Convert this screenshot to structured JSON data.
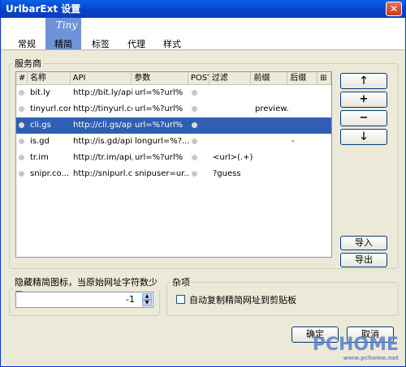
{
  "window": {
    "title": "UrlbarExt 设置",
    "close_label": "✕"
  },
  "tabs": [
    {
      "label": "常规",
      "active": false
    },
    {
      "label": "精简",
      "active": true,
      "icon_text": "Tiny"
    },
    {
      "label": "标签",
      "active": false
    },
    {
      "label": "代理",
      "active": false
    },
    {
      "label": "样式",
      "active": false
    }
  ],
  "providers": {
    "legend": "服务商",
    "columns": [
      "#",
      "名称",
      "API",
      "参数",
      "POST",
      "过滤",
      "前缀",
      "后缀",
      "⊞"
    ],
    "rows": [
      {
        "name": "bit.ly",
        "api": "http://bit.ly/api",
        "params": "url=%?url%",
        "post": "",
        "filter": "",
        "prefix": "",
        "suffix": "",
        "status": "off",
        "selected": false
      },
      {
        "name": "tinyurl.com",
        "api": "http://tinyurl.co...",
        "params": "url=%?url%",
        "post": "",
        "filter": "",
        "prefix": "preview.",
        "suffix": "",
        "status": "off",
        "selected": false
      },
      {
        "name": "cli.gs",
        "api": "http://cli.gs/ap...",
        "params": "url=%?url%",
        "post": "",
        "filter": "",
        "prefix": "",
        "suffix": "",
        "status": "ok",
        "selected": true
      },
      {
        "name": "is.gd",
        "api": "http://is.gd/api...",
        "params": "longurl=%?...",
        "post": "",
        "filter": "",
        "prefix": "",
        "suffix": "-",
        "status": "off",
        "selected": false
      },
      {
        "name": "tr.im",
        "api": "http://tr.im/api/...",
        "params": "url=%?url%",
        "post": "",
        "filter": "<url>(.+)...",
        "prefix": "",
        "suffix": "",
        "status": "off",
        "selected": false
      },
      {
        "name": "snipr.co...",
        "api": "http://snipurl.c...",
        "params": "snipuser=ur...",
        "post": "",
        "filter": "?guess",
        "prefix": "",
        "suffix": "",
        "status": "off",
        "selected": false
      }
    ]
  },
  "side_buttons": {
    "up": "🡑",
    "add": "+",
    "remove": "−",
    "down": "🡓",
    "import": "导入",
    "export": "导出"
  },
  "hide_icon": {
    "legend": "隐藏精简图标，当原始网址字符数少于:",
    "value": "-1"
  },
  "misc": {
    "legend": "杂项",
    "copy_label": "自动复制精简网址到剪贴板"
  },
  "dialog": {
    "ok_label": "确定",
    "cancel_label": "取消"
  },
  "watermark": {
    "text": "PCHOME",
    "sub": "www.pchome.net"
  }
}
